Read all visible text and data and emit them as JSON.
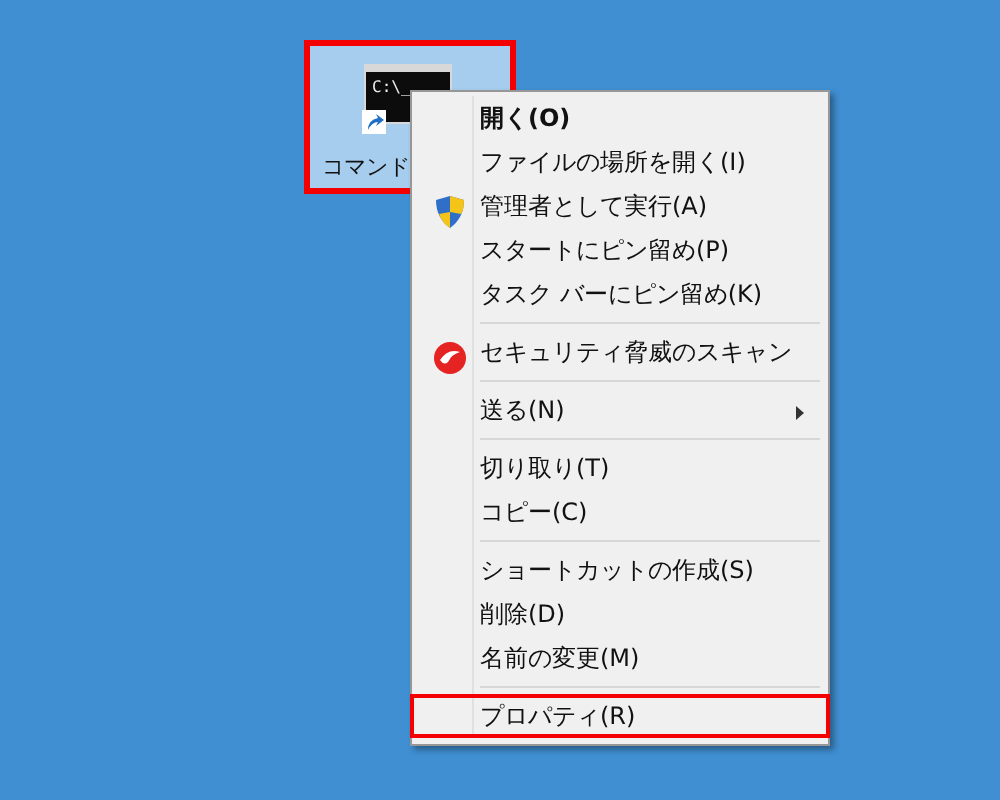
{
  "desktop_icon": {
    "label": "コマンド",
    "screen_text": "C:\\_",
    "selected": true,
    "outlined": true,
    "shortcut": true
  },
  "context_menu": {
    "groups": [
      [
        {
          "label": "開く(O)",
          "default": true,
          "kind": "plain",
          "submenu": false,
          "outlined": false
        },
        {
          "label": "ファイルの場所を開く(I)",
          "default": false,
          "kind": "plain",
          "submenu": false,
          "outlined": false
        },
        {
          "label": "管理者として実行(A)",
          "default": false,
          "kind": "shield",
          "submenu": false,
          "outlined": false
        },
        {
          "label": "スタートにピン留め(P)",
          "default": false,
          "kind": "plain",
          "submenu": false,
          "outlined": false
        },
        {
          "label": "タスク バーにピン留め(K)",
          "default": false,
          "kind": "plain",
          "submenu": false,
          "outlined": false
        }
      ],
      [
        {
          "label": "セキュリティ脅威のスキャン",
          "default": false,
          "kind": "scan",
          "submenu": false,
          "outlined": false
        }
      ],
      [
        {
          "label": "送る(N)",
          "default": false,
          "kind": "plain",
          "submenu": true,
          "outlined": false
        }
      ],
      [
        {
          "label": "切り取り(T)",
          "default": false,
          "kind": "plain",
          "submenu": false,
          "outlined": false
        },
        {
          "label": "コピー(C)",
          "default": false,
          "kind": "plain",
          "submenu": false,
          "outlined": false
        }
      ],
      [
        {
          "label": "ショートカットの作成(S)",
          "default": false,
          "kind": "plain",
          "submenu": false,
          "outlined": false
        },
        {
          "label": "削除(D)",
          "default": false,
          "kind": "plain",
          "submenu": false,
          "outlined": false
        },
        {
          "label": "名前の変更(M)",
          "default": false,
          "kind": "plain",
          "submenu": false,
          "outlined": false
        }
      ],
      [
        {
          "label": "プロパティ(R)",
          "default": false,
          "kind": "plain",
          "submenu": false,
          "outlined": true
        }
      ]
    ]
  }
}
